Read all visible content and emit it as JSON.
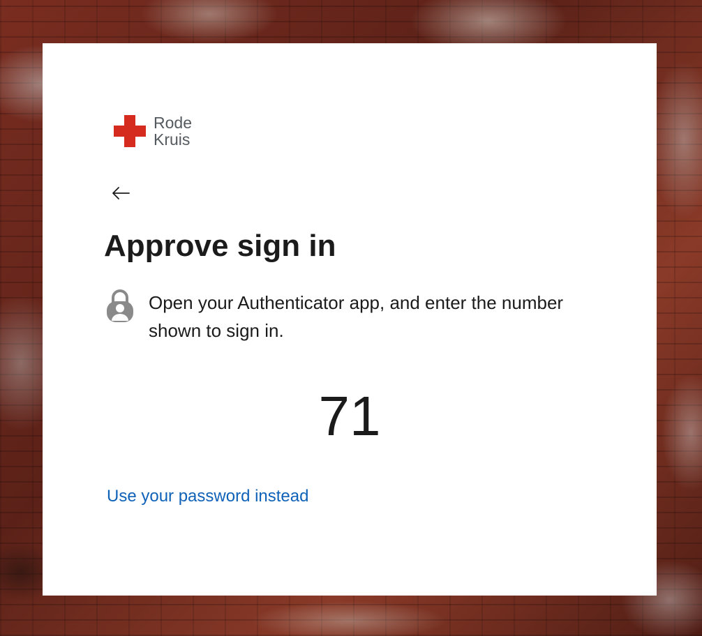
{
  "logo": {
    "line1": "Rode",
    "line2": "Kruis",
    "cross_color": "#d52b1e",
    "text_color": "#555a5f"
  },
  "nav": {
    "back_icon": "arrow-left-icon"
  },
  "heading": "Approve sign in",
  "instruction": {
    "icon": "lock-icon",
    "text": "Open your Authenticator app, and enter the number shown to sign in."
  },
  "verification_number": "71",
  "alt_link": {
    "label": "Use your password instead",
    "color": "#0f62b8"
  }
}
